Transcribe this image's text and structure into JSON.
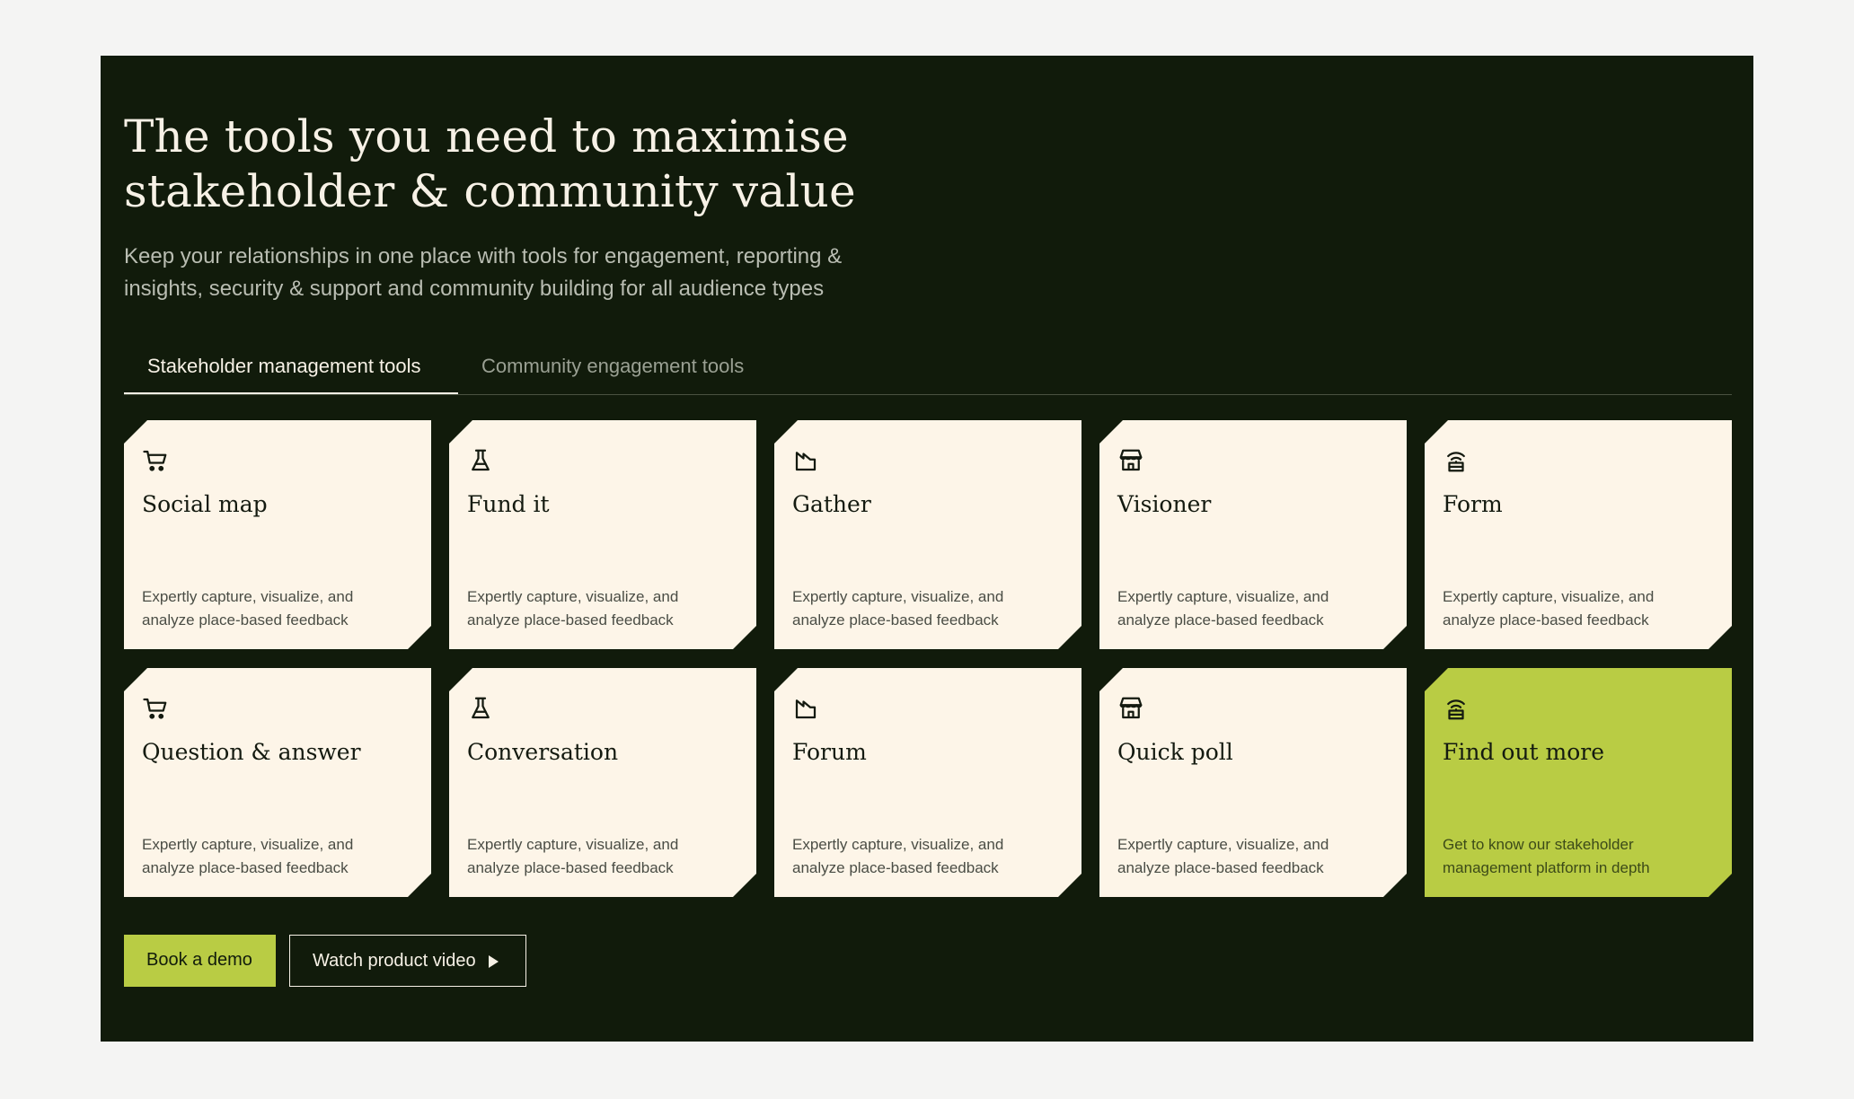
{
  "hero": {
    "title_line1": "The tools you need to maximise",
    "title_line2": "stakeholder & community value",
    "subtitle_line1": "Keep your relationships in one place with tools for engagement, reporting &",
    "subtitle_line2": "insights, security & support and community building for all audience types"
  },
  "tabs": [
    {
      "label": "Stakeholder management tools",
      "active": true
    },
    {
      "label": "Community engagement tools",
      "active": false
    }
  ],
  "cards": [
    {
      "title": "Social map",
      "desc1": "Expertly capture, visualize, and",
      "desc2": "analyze place-based feedback",
      "icon": "cart-icon"
    },
    {
      "title": "Fund it",
      "desc1": "Expertly capture, visualize, and",
      "desc2": "analyze place-based feedback",
      "icon": "flask-icon"
    },
    {
      "title": "Gather",
      "desc1": "Expertly capture, visualize, and",
      "desc2": "analyze place-based feedback",
      "icon": "factory-icon"
    },
    {
      "title": "Visioner",
      "desc1": "Expertly capture, visualize, and",
      "desc2": "analyze place-based feedback",
      "icon": "store-icon"
    },
    {
      "title": "Form",
      "desc1": "Expertly capture, visualize, and",
      "desc2": "analyze place-based feedback",
      "icon": "broadcast-icon"
    },
    {
      "title": "Question & answer",
      "desc1": "Expertly capture, visualize, and",
      "desc2": "analyze place-based feedback",
      "icon": "cart-icon"
    },
    {
      "title": "Conversation",
      "desc1": "Expertly capture, visualize, and",
      "desc2": "analyze place-based feedback",
      "icon": "flask-icon"
    },
    {
      "title": "Forum",
      "desc1": "Expertly capture, visualize, and",
      "desc2": "analyze place-based feedback",
      "icon": "factory-icon"
    },
    {
      "title": "Quick poll",
      "desc1": "Expertly capture, visualize, and",
      "desc2": "analyze place-based feedback",
      "icon": "store-icon"
    },
    {
      "title": "Find out more",
      "desc1": "Get to know our stakeholder",
      "desc2": "management platform in depth",
      "icon": "broadcast-icon"
    }
  ],
  "buttons": {
    "demo": "Book a demo",
    "video": "Watch product video"
  },
  "colors": {
    "panel_bg": "#111b0b",
    "card_bg": "#fdf5e8",
    "accent": "#b9cc44",
    "page_bg": "#f4f4f3"
  }
}
